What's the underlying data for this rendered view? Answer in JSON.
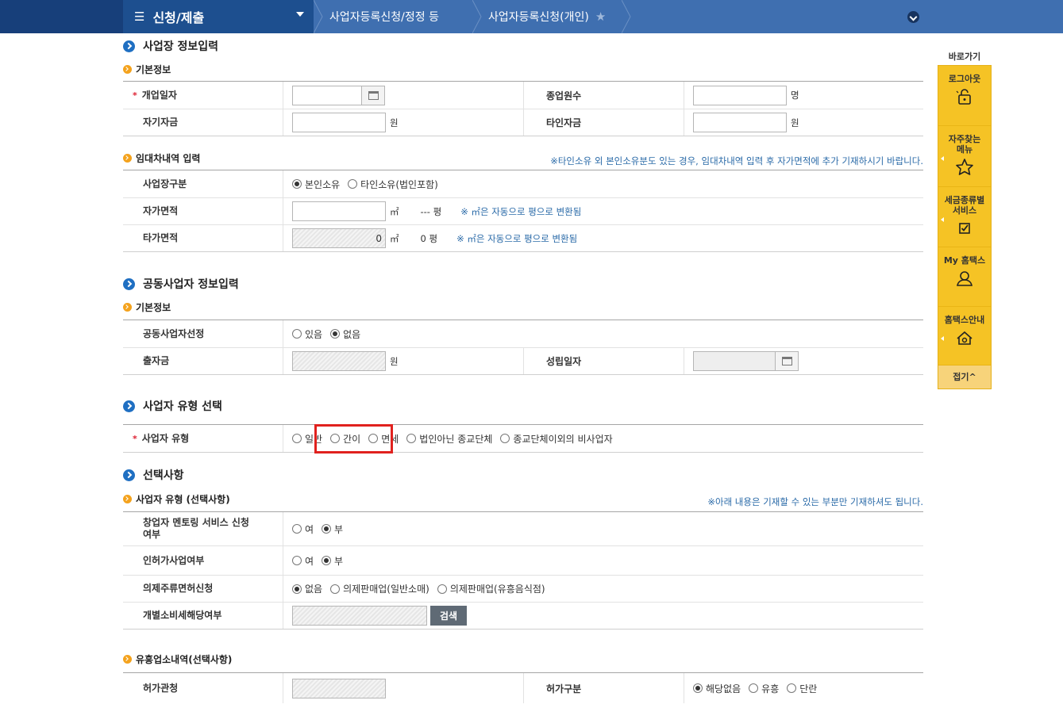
{
  "nav": {
    "menu_label": "신청/제출",
    "breadcrumb_1": "사업자등록신청/정정 등",
    "breadcrumb_2": "사업자등록신청(개인)"
  },
  "sections": {
    "workplace": "사업장 정보입력",
    "partner": "공동사업자 정보입력",
    "biztype": "사업자 유형 선택",
    "optional": "선택사항"
  },
  "basic": {
    "title": "기본정보",
    "open_date_label": "개업일자",
    "employees_label": "종업원수",
    "employees_unit": "명",
    "own_capital_label": "자기자금",
    "own_capital_unit": "원",
    "other_capital_label": "타인자금",
    "other_capital_unit": "원"
  },
  "lease": {
    "title": "임대차내역 입력",
    "note": "※타인소유 외 본인소유분도 있는 경우, 임대차내역 입력 후 자가면적에 추가 기재하시기 바랍니다.",
    "division_label": "사업장구분",
    "opt_own": "본인소유",
    "opt_other": "타인소유(법인포함)",
    "own_area_label": "자가면적",
    "own_area_unit": "㎡",
    "own_area_pyeong": "--- 평",
    "own_area_hint": "※ ㎡은 자동으로 평으로 변환됨",
    "other_area_label": "타가면적",
    "other_area_value": "0",
    "other_area_unit": "㎡",
    "other_area_pyeong": "0 평",
    "other_area_hint": "※ ㎡은 자동으로 평으로 변환됨"
  },
  "partner_basic": {
    "title": "기본정보",
    "select_label": "공동사업자선정",
    "opt_yes": "있음",
    "opt_no": "없음",
    "investment_label": "출자금",
    "investment_unit": "원",
    "established_label": "성립일자"
  },
  "biztype": {
    "label": "사업자 유형",
    "opt_general": "일반",
    "opt_simple": "간이",
    "opt_exempt": "면세",
    "opt_religious": "법인아닌 종교단체",
    "opt_other": "종교단체이외의 비사업자"
  },
  "optional": {
    "title": "사업자 유형 (선택사항)",
    "note": "※아래 내용은 기재할 수 있는 부분만 기재하셔도 됩니다.",
    "mentoring_label": "창업자 멘토링 서비스 신청여부",
    "permit_label": "인허가사업여부",
    "opt_yes": "여",
    "opt_no": "부",
    "liquor_label": "의제주류면허신청",
    "liquor_none": "없음",
    "liquor_general": "의제판매업(일반소매)",
    "liquor_bar": "의제판매업(유흥음식점)",
    "excise_label": "개별소비세해당여부",
    "search_button": "검색"
  },
  "entertainment": {
    "title": "유흥업소내역(선택사항)",
    "authority_label": "허가관청",
    "division_label": "허가구분",
    "opt_none": "해당없음",
    "opt_ent": "유흥",
    "opt_bar": "단란"
  },
  "quick": {
    "header": "바로가기",
    "logout": "로그아웃",
    "faq_menu": "자주찾는 메뉴",
    "tax_service": "세금종류별 서비스",
    "my_hometax": "My 홈택스",
    "hometax_guide": "홈택스안내",
    "fold": "접기^"
  }
}
